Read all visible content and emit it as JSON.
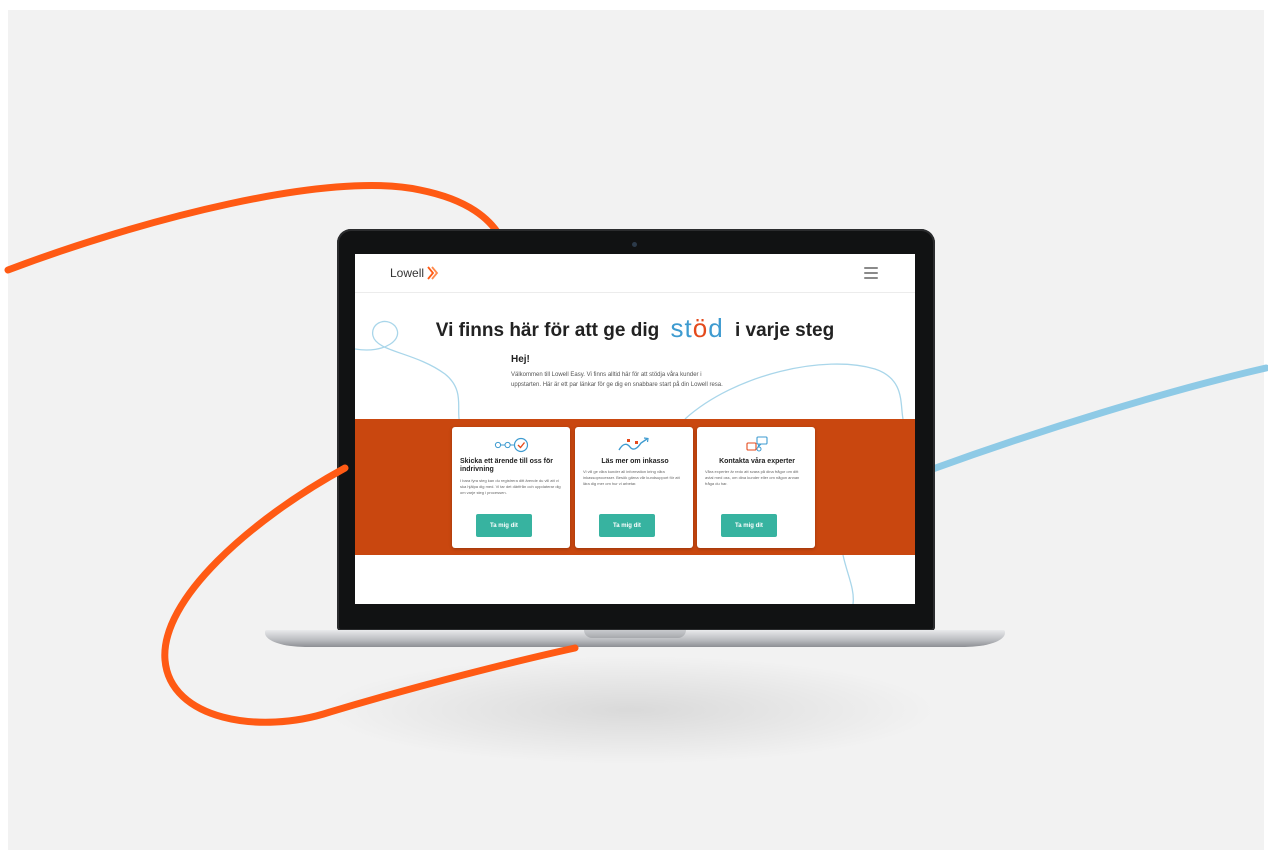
{
  "brand": {
    "name": "Lowell"
  },
  "colors": {
    "accent_orange": "#ff5a14",
    "band_orange": "#c9470f",
    "accent_blue": "#8ecae6",
    "button_teal": "#37b3a0"
  },
  "header": {
    "menu_icon": "hamburger-menu-icon"
  },
  "hero": {
    "title_before": "Vi finns här för att ge dig",
    "title_accent_1": "st",
    "title_accent_2": "ö",
    "title_accent_3": "d",
    "title_after": "i varje steg"
  },
  "greeting": {
    "title": "Hej!",
    "line1": "Välkommen till Lowell Easy. Vi finns alltid här för att stödja våra kunder i",
    "line2": "uppstarten. Här är ett par länkar för ge dig en snabbare start på din Lowell resa."
  },
  "cards": [
    {
      "icon": "process-check-icon",
      "title_line1": "Skicka ett ärende till oss för",
      "title_line2": "indrivning",
      "text": "I bara fyra steg kan du registrera ditt ärende du vill att vi ska hjälpa dig med. Vi tar det därifrån och uppdaterar dig om varje steg i processen.",
      "button": "Ta mig dit"
    },
    {
      "icon": "growth-chart-icon",
      "title_line1": "Läs mer om inkasso",
      "title_line2": "",
      "text": "Vi vill ge våra kunder all information kring våra inkassoprocesser. Besök gärna vår kundsupport för att lära dig mer om hur vi arbetar.",
      "button": "Ta mig dit"
    },
    {
      "icon": "chat-bubbles-icon",
      "title_line1": "Kontakta våra experter",
      "title_line2": "",
      "text": "Våra experter är redo att svara på dina frågor om ditt avtal med oss, om dina kunder eller om någon annan fråga du har.",
      "button": "Ta mig dit"
    }
  ]
}
